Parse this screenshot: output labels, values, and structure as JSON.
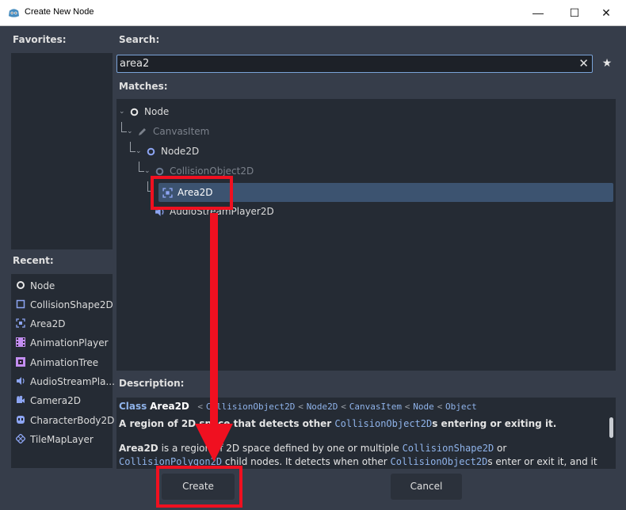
{
  "window": {
    "title": "Create New Node",
    "minimize": "—",
    "maximize": "☐",
    "close": "✕"
  },
  "favorites": {
    "label": "Favorites:"
  },
  "search": {
    "label": "Search:",
    "value": "area2"
  },
  "matches": {
    "label": "Matches:",
    "nodes": [
      {
        "label": "Node",
        "icon": "node-circle-icon",
        "dim": false
      },
      {
        "label": "CanvasItem",
        "icon": "pencil-icon",
        "dim": true
      },
      {
        "label": "Node2D",
        "icon": "node2d-circle-icon",
        "dim": false
      },
      {
        "label": "CollisionObject2D",
        "icon": "collision-object-icon",
        "dim": true
      },
      {
        "label": "Area2D",
        "icon": "area2d-icon",
        "dim": false,
        "selected": true
      },
      {
        "label": "AudioStreamPlayer2D",
        "icon": "speaker-icon",
        "dim": false
      }
    ]
  },
  "recent": {
    "label": "Recent:",
    "items": [
      {
        "label": "Node",
        "icon": "node-circle-icon"
      },
      {
        "label": "CollisionShape2D",
        "icon": "collision-shape-icon"
      },
      {
        "label": "Area2D",
        "icon": "area2d-icon"
      },
      {
        "label": "AnimationPlayer",
        "icon": "animation-player-icon"
      },
      {
        "label": "AnimationTree",
        "icon": "animation-tree-icon"
      },
      {
        "label": "AudioStreamPla...",
        "icon": "speaker-icon"
      },
      {
        "label": "Camera2D",
        "icon": "camera-icon"
      },
      {
        "label": "CharacterBody2D",
        "icon": "character-body-icon"
      },
      {
        "label": "TileMapLayer",
        "icon": "tilemap-icon"
      }
    ]
  },
  "description": {
    "label": "Description:",
    "class_prefix": "Class",
    "class_name": "Area2D",
    "inheritance": [
      "CollisionObject2D",
      "Node2D",
      "CanvasItem",
      "Node",
      "Object"
    ],
    "separator": "<",
    "summary_a": "A region of 2D space that detects other ",
    "summary_link": "CollisionObject2D",
    "summary_b": "s entering or exiting it.",
    "body1_a": "Area2D",
    "body1_b": " is a region of 2D space defined by one or multiple ",
    "body1_link": "CollisionShape2D",
    "body1_c": " or",
    "body2_link": "CollisionPolygon2D",
    "body2_a": " child nodes. It detects when other ",
    "body2_link2": "CollisionObject2D",
    "body2_b": "s enter or exit it, and it"
  },
  "buttons": {
    "create": "Create",
    "cancel": "Cancel"
  },
  "colors": {
    "accent": "#7aa3d8",
    "selected": "#3c5370",
    "highlight": "#f01020",
    "node2d": "#8da5f3"
  }
}
